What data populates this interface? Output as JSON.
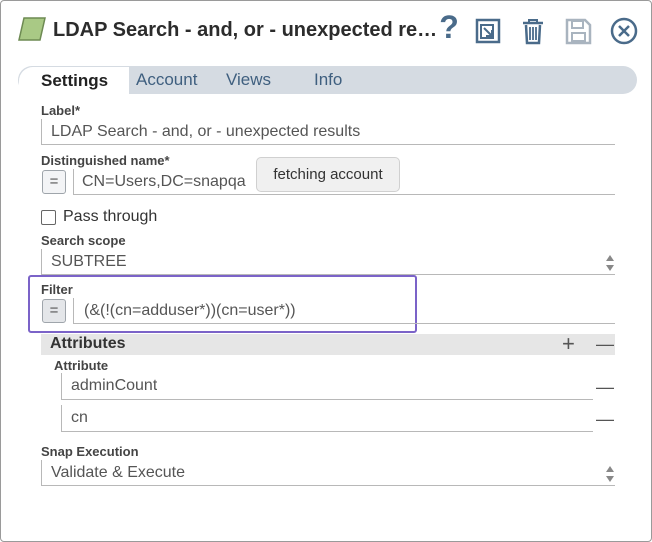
{
  "header": {
    "title": "LDAP Search - and, or - unexpected res…",
    "help_label": "?"
  },
  "tabs": [
    {
      "label": "Settings"
    },
    {
      "label": "Account"
    },
    {
      "label": "Views"
    },
    {
      "label": "Info"
    }
  ],
  "form": {
    "label": {
      "title": "Label*",
      "value": "LDAP Search - and, or - unexpected results"
    },
    "dn": {
      "title": "Distinguished name*",
      "value": "CN=Users,DC=snapqa",
      "expr": "="
    },
    "tooltip": "fetching account",
    "pass_through": {
      "label": "Pass through"
    },
    "scope": {
      "title": "Search scope",
      "value": "SUBTREE"
    },
    "filter": {
      "title": "Filter",
      "value": "(&(!(cn=adduser*))(cn=user*))",
      "expr": "="
    },
    "attributes": {
      "title": "Attributes",
      "add": "+",
      "remove": "—",
      "column": "Attribute",
      "rows": [
        {
          "value": "adminCount",
          "remove": "—"
        },
        {
          "value": "cn",
          "remove": "—"
        }
      ]
    },
    "execution": {
      "title": "Snap Execution",
      "value": "Validate & Execute"
    }
  }
}
